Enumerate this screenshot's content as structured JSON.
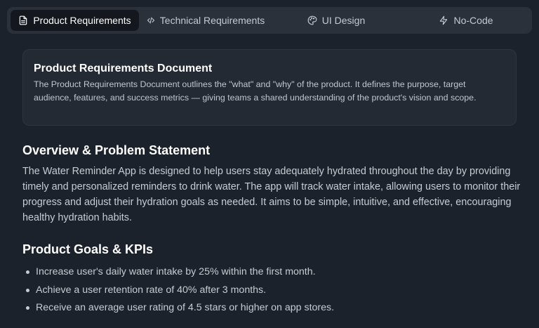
{
  "tabs": [
    {
      "label": "Product Requirements",
      "icon": "document-icon",
      "active": true
    },
    {
      "label": "Technical Requirements",
      "icon": "code-icon",
      "active": false
    },
    {
      "label": "UI Design",
      "icon": "palette-icon",
      "active": false
    },
    {
      "label": "No-Code",
      "icon": "lightning-icon",
      "active": false
    }
  ],
  "info_card": {
    "title": "Product Requirements Document",
    "text": "The Product Requirements Document outlines the \"what\" and \"why\" of the product. It defines the purpose, target audience, features, and success metrics — giving teams a shared understanding of the product's vision and scope."
  },
  "overview": {
    "heading": "Overview & Problem Statement",
    "text": "The Water Reminder App is designed to help users stay adequately hydrated throughout the day by providing timely and personalized reminders to drink water. The app will track water intake, allowing users to monitor their progress and adjust their hydration goals as needed. It aims to be simple, intuitive, and effective, encouraging healthy hydration habits."
  },
  "goals": {
    "heading": "Product Goals & KPIs",
    "items": [
      "Increase user's daily water intake by 25% within the first month.",
      "Achieve a user retention rate of 40% after 3 months.",
      "Receive an average user rating of 4.5 stars or higher on app stores."
    ]
  },
  "colors": {
    "background": "#1c222b",
    "tabbar": "#2a313b",
    "active_tab": "#14181e",
    "card": "#242a33",
    "text": "#c7ccd3",
    "heading": "#ffffff"
  }
}
